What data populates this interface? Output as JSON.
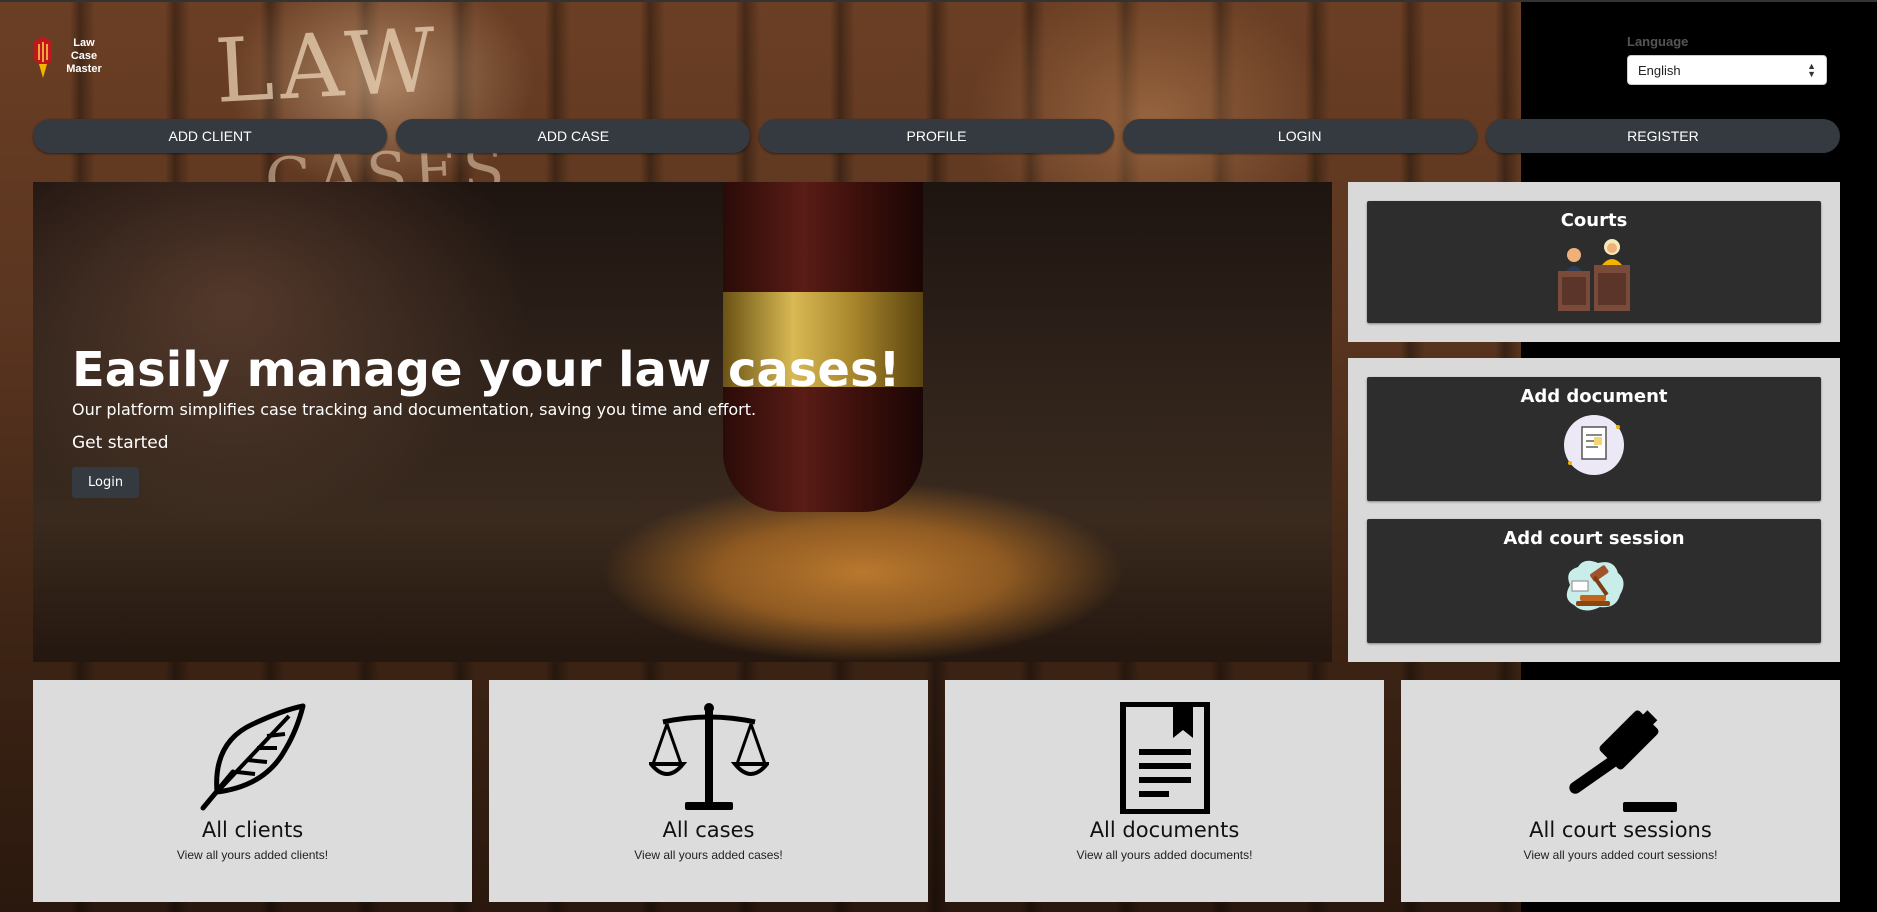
{
  "header": {
    "logo_text_line1": "Law",
    "logo_text_line2": "Case",
    "logo_text_line3": "Master",
    "language_label": "Language",
    "language_selected": "English"
  },
  "nav": {
    "items": [
      {
        "label": "ADD CLIENT"
      },
      {
        "label": "ADD CASE"
      },
      {
        "label": "PROFILE"
      },
      {
        "label": "LOGIN"
      },
      {
        "label": "REGISTER"
      }
    ]
  },
  "hero": {
    "title": "Easily manage your law cases!",
    "subtitle": "Our platform simplifies case tracking and documentation, saving you time and effort.",
    "get_started": "Get started",
    "login_button": "Login"
  },
  "side_cards": [
    {
      "title": "Courts",
      "icon": "courtroom-icon"
    },
    {
      "title": "Add document",
      "icon": "document-icon"
    },
    {
      "title": "Add court session",
      "icon": "gavel-session-icon"
    }
  ],
  "tiles": [
    {
      "title": "All clients",
      "subtitle": "View all yours added clients!",
      "icon": "feather-icon"
    },
    {
      "title": "All cases",
      "subtitle": "View all yours added cases!",
      "icon": "scales-icon"
    },
    {
      "title": "All documents",
      "subtitle": "View all yours added documents!",
      "icon": "document-icon"
    },
    {
      "title": "All court sessions",
      "subtitle": "View all yours added court sessions!",
      "icon": "gavel-icon"
    }
  ],
  "background_text": [
    "LAW",
    "CASES"
  ],
  "colors": {
    "nav_button": "#343a40",
    "card_dark": "#2d2d2d",
    "panel_light": "#d9d9d9",
    "tile_light": "#dcdcdc"
  }
}
